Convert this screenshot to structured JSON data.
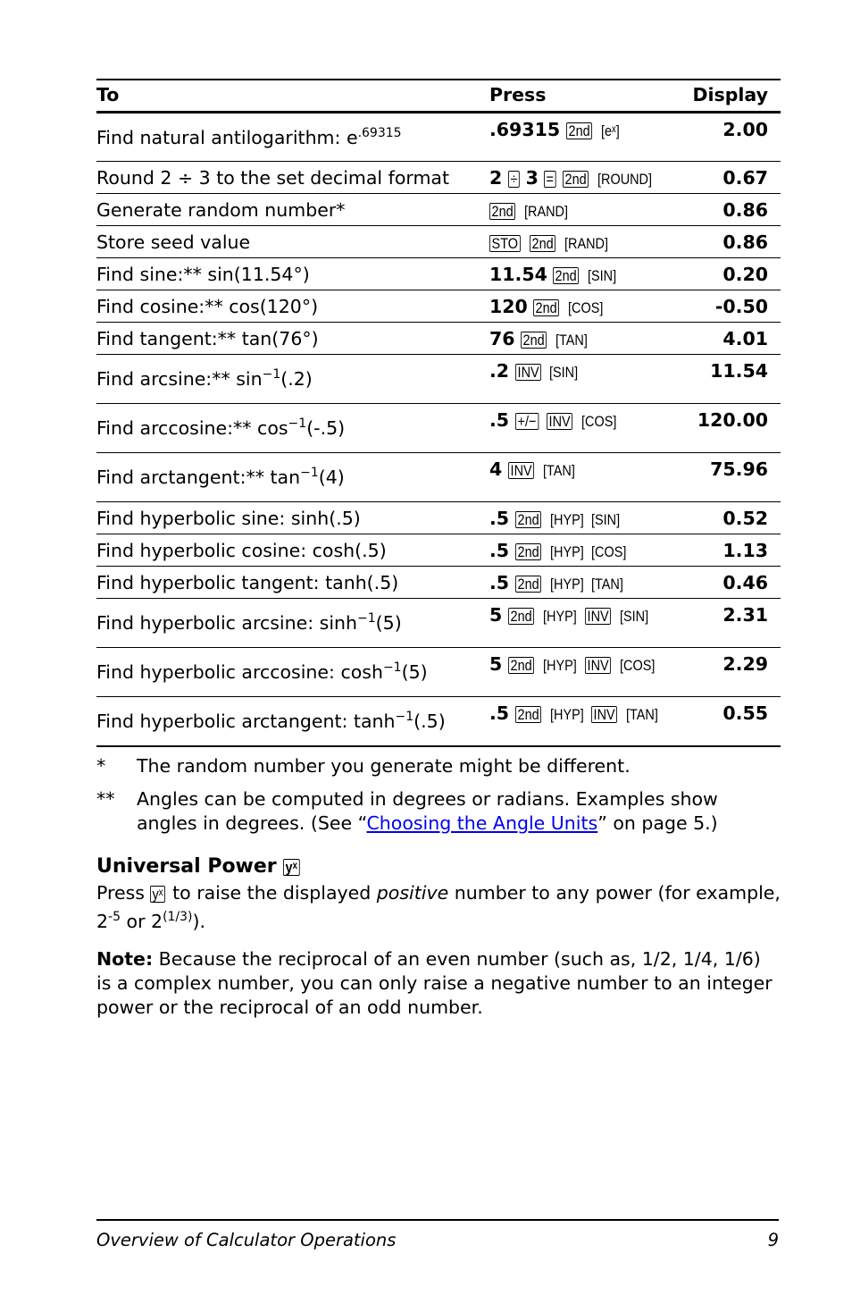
{
  "table": {
    "headers": {
      "to": "To",
      "press": "Press",
      "display": "Display"
    },
    "rows": [
      {
        "to": "Find natural antilogarithm: e",
        "to_sup": ".69315",
        "press": [
          {
            "t": "num",
            "v": ".69315"
          },
          {
            "t": "key",
            "v": "2nd"
          },
          {
            "t": "skey",
            "v": "[eˣ]"
          }
        ],
        "display": "2.00",
        "tall": true
      },
      {
        "to": "Round 2 ÷ 3 to the set decimal format",
        "press": [
          {
            "t": "num",
            "v": "2"
          },
          {
            "t": "key",
            "v": "÷"
          },
          {
            "t": "num",
            "v": "3"
          },
          {
            "t": "key",
            "v": "="
          },
          {
            "t": "key",
            "v": "2nd"
          },
          {
            "t": "skey",
            "v": "[ROUND]"
          }
        ],
        "display": "0.67"
      },
      {
        "to": "Generate random number*",
        "press": [
          {
            "t": "key",
            "v": "2nd"
          },
          {
            "t": "skey",
            "v": "[RAND]"
          }
        ],
        "display": "0.86"
      },
      {
        "to": "Store seed value",
        "press": [
          {
            "t": "key",
            "v": "STO"
          },
          {
            "t": "key",
            "v": "2nd"
          },
          {
            "t": "skey",
            "v": "[RAND]"
          }
        ],
        "display": "0.86"
      },
      {
        "to": "Find sine:** sin(11.54°)",
        "press": [
          {
            "t": "num",
            "v": "11.54"
          },
          {
            "t": "key",
            "v": "2nd"
          },
          {
            "t": "skey",
            "v": "[SIN]"
          }
        ],
        "display": "0.20"
      },
      {
        "to": "Find cosine:** cos(120°)",
        "press": [
          {
            "t": "num",
            "v": "120"
          },
          {
            "t": "key",
            "v": "2nd"
          },
          {
            "t": "skey",
            "v": "[COS]"
          }
        ],
        "display": "-0.50"
      },
      {
        "to": "Find tangent:** tan(76°)",
        "press": [
          {
            "t": "num",
            "v": "76"
          },
          {
            "t": "key",
            "v": "2nd"
          },
          {
            "t": "skey",
            "v": "[TAN]"
          }
        ],
        "display": "4.01"
      },
      {
        "to": "Find arcsine:** sin",
        "to_sup": "−1",
        "to_after": "(.2)",
        "press": [
          {
            "t": "num",
            "v": ".2"
          },
          {
            "t": "key",
            "v": "INV"
          },
          {
            "t": "skey",
            "v": "[SIN]"
          }
        ],
        "display": "11.54",
        "tall": true
      },
      {
        "to": "Find arccosine:** cos",
        "to_sup": "−1",
        "to_after": "(-.5)",
        "press": [
          {
            "t": "num",
            "v": ".5"
          },
          {
            "t": "key",
            "v": "+/−"
          },
          {
            "t": "key",
            "v": "INV"
          },
          {
            "t": "skey",
            "v": "[COS]"
          }
        ],
        "display": "120.00",
        "tall": true
      },
      {
        "to": "Find arctangent:** tan",
        "to_sup": "−1",
        "to_after": "(4)",
        "press": [
          {
            "t": "num",
            "v": "4"
          },
          {
            "t": "key",
            "v": "INV"
          },
          {
            "t": "skey",
            "v": "[TAN]"
          }
        ],
        "display": "75.96",
        "tall": true
      },
      {
        "to": "Find hyperbolic sine: sinh(.5)",
        "press": [
          {
            "t": "num",
            "v": ".5"
          },
          {
            "t": "key",
            "v": "2nd"
          },
          {
            "t": "skey",
            "v": "[HYP]"
          },
          {
            "t": "skey",
            "v": "[SIN]"
          }
        ],
        "display": "0.52"
      },
      {
        "to": "Find hyperbolic cosine: cosh(.5)",
        "press": [
          {
            "t": "num",
            "v": ".5"
          },
          {
            "t": "key",
            "v": "2nd"
          },
          {
            "t": "skey",
            "v": "[HYP]"
          },
          {
            "t": "skey",
            "v": "[COS]"
          }
        ],
        "display": "1.13"
      },
      {
        "to": "Find hyperbolic tangent: tanh(.5)",
        "press": [
          {
            "t": "num",
            "v": ".5"
          },
          {
            "t": "key",
            "v": "2nd"
          },
          {
            "t": "skey",
            "v": "[HYP]"
          },
          {
            "t": "skey",
            "v": "[TAN]"
          }
        ],
        "display": "0.46"
      },
      {
        "to": "Find hyperbolic arcsine: sinh",
        "to_sup": "−1",
        "to_after": "(5)",
        "press": [
          {
            "t": "num",
            "v": "5"
          },
          {
            "t": "key",
            "v": "2nd"
          },
          {
            "t": "skey",
            "v": "[HYP]"
          },
          {
            "t": "key",
            "v": "INV"
          },
          {
            "t": "skey",
            "v": "[SIN]"
          }
        ],
        "display": "2.31",
        "tall": true
      },
      {
        "to": "Find hyperbolic arccosine: cosh",
        "to_sup": "−1",
        "to_after": "(5)",
        "press": [
          {
            "t": "num",
            "v": "5"
          },
          {
            "t": "key",
            "v": "2nd"
          },
          {
            "t": "skey",
            "v": "[HYP]"
          },
          {
            "t": "key",
            "v": "INV"
          },
          {
            "t": "skey",
            "v": "[COS]"
          }
        ],
        "display": "2.29",
        "tall": true
      },
      {
        "to": "Find hyperbolic arctangent: tanh",
        "to_sup": "−1",
        "to_after": "(.5)",
        "press": [
          {
            "t": "num",
            "v": ".5"
          },
          {
            "t": "key",
            "v": "2nd"
          },
          {
            "t": "skey",
            "v": "[HYP]"
          },
          {
            "t": "key",
            "v": "INV"
          },
          {
            "t": "skey",
            "v": "[TAN]"
          }
        ],
        "display": "0.55",
        "tall": true
      }
    ]
  },
  "notes": [
    {
      "mark": "*",
      "text": "The random number you generate might be different."
    },
    {
      "mark": "**",
      "text_before": "Angles can be computed in degrees or radians. Examples show angles in degrees. (See “",
      "link": "Choosing the Angle Units",
      "text_after": "” on page 5.)"
    }
  ],
  "section": {
    "heading": "Universal Power",
    "heading_key": "yˣ",
    "para1_before": "Press",
    "para1_key": "yˣ",
    "para1_mid": "to raise the displayed",
    "para1_italic": "positive",
    "para1_after": "number to any power (for example, 2",
    "sup1": "-5",
    "para1_or": " or 2",
    "sup2": "(1/3)",
    "para1_end": ").",
    "note_label": "Note:",
    "note_text": " Because the reciprocal of an even number (such as, 1/2, 1/4, 1/6) is a complex number, you can only raise a negative number to an integer power or the reciprocal of an odd number."
  },
  "footer": {
    "title": "Overview of Calculator Operations",
    "page": "9"
  },
  "colors": {
    "link": "#0000ee",
    "text": "#000000"
  }
}
